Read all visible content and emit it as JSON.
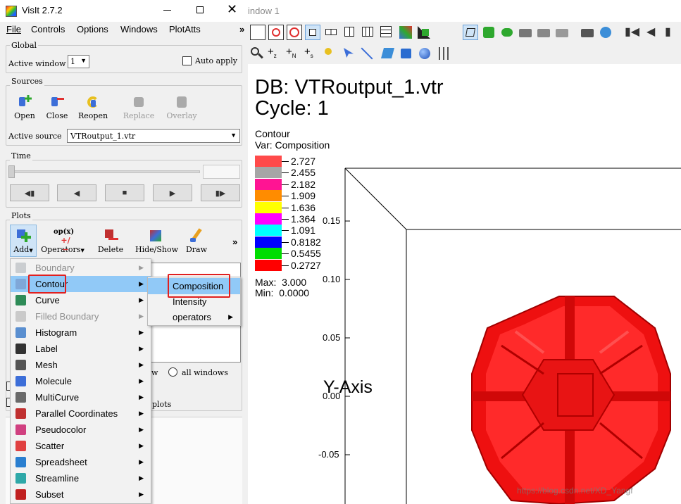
{
  "left_window": {
    "title": "VisIt 2.7.2",
    "menu": [
      "File",
      "Controls",
      "Options",
      "Windows",
      "PlotAtts"
    ],
    "menu_overflow": "»",
    "global": {
      "title": "Global",
      "active_window_label": "Active window",
      "active_window_value": "1",
      "auto_apply_label": "Auto apply"
    },
    "sources": {
      "title": "Sources",
      "buttons": [
        "Open",
        "Close",
        "Reopen",
        "Replace",
        "Overlay"
      ],
      "active_source_label": "Active source",
      "active_source_value": "VTRoutput_1.vtr"
    },
    "time": {
      "title": "Time"
    },
    "plots": {
      "title": "Plots",
      "buttons": [
        "Add",
        "Operators",
        "Delete",
        "Hide/Show",
        "Draw"
      ],
      "overflow": "»",
      "all_windows_label": "all windows",
      "partial_w": "w",
      "partial_plots": "plots"
    }
  },
  "add_menu": {
    "items": [
      {
        "label": "Boundary",
        "disabled": true
      },
      {
        "label": "Contour",
        "highlighted": true
      },
      {
        "label": "Curve"
      },
      {
        "label": "Filled Boundary",
        "disabled": true
      },
      {
        "label": "Histogram"
      },
      {
        "label": "Label"
      },
      {
        "label": "Mesh"
      },
      {
        "label": "Molecule"
      },
      {
        "label": "MultiCurve"
      },
      {
        "label": "Parallel Coordinates"
      },
      {
        "label": "Pseudocolor"
      },
      {
        "label": "Scatter"
      },
      {
        "label": "Spreadsheet"
      },
      {
        "label": "Streamline"
      },
      {
        "label": "Subset"
      }
    ]
  },
  "contour_submenu": {
    "items": [
      "Composition",
      "Intensity",
      "operators"
    ]
  },
  "render_window": {
    "title": "indow 1",
    "db_line": "DB: VTRoutput_1.vtr",
    "cycle_line": "Cycle: 1",
    "plot_name": "Contour",
    "var_line": "Var: Composition",
    "legend": {
      "entries": [
        {
          "value": "2.727",
          "color": "#ff4a4a"
        },
        {
          "value": "2.455",
          "color": "#a6a6a6"
        },
        {
          "value": "2.182",
          "color": "#ff1493"
        },
        {
          "value": "1.909",
          "color": "#ff8c00"
        },
        {
          "value": "1.636",
          "color": "#ffff00"
        },
        {
          "value": "1.364",
          "color": "#ff00ff"
        },
        {
          "value": "1.091",
          "color": "#00ffff"
        },
        {
          "value": "0.8182",
          "color": "#0000ff"
        },
        {
          "value": "0.5455",
          "color": "#00dd00"
        },
        {
          "value": "0.2727",
          "color": "#ff0000"
        }
      ],
      "max_line": "Max:  3.000",
      "min_line": "Min:  0.0000"
    },
    "y_axis_label": "Y-Axis",
    "y_ticks": [
      "0.15",
      "0.10",
      "0.05",
      "0.00",
      "-0.05"
    ],
    "watermark": "https://blog.csdn.net/XD_Yangf"
  }
}
